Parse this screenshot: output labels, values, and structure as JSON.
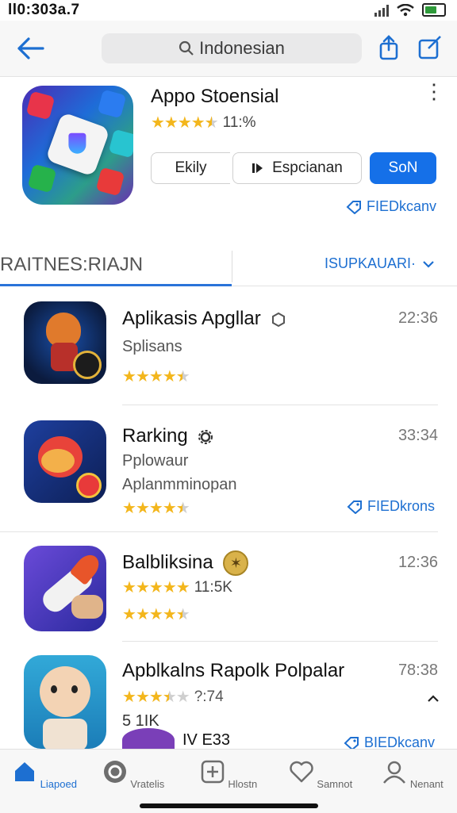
{
  "status": {
    "time": "ll0:303a.7"
  },
  "nav": {
    "search_text": "Indonesian"
  },
  "hero": {
    "title": "Appo Stoensial",
    "rating_text": "11:%",
    "btn_left": "Ekily",
    "btn_mid": "Espcianan",
    "btn_primary": "SoN",
    "link": "FIEDkcanv"
  },
  "tabs": {
    "left": "RAITNES:RIAJN",
    "right": "ISUPKAUARI·"
  },
  "list": [
    {
      "title": "Aplikasis Apgllar",
      "sub": "Splisans",
      "time": "22:36",
      "stars": 4.5
    },
    {
      "title": "Rarking",
      "sub": "Pplowaur",
      "sub2": "Aplanmminopan",
      "time": "33:34",
      "stars": 4.5,
      "link": "FIEDkrons"
    },
    {
      "title": "Balbliksina",
      "rating_text": "11:5K",
      "time": "12:36",
      "stars": 5,
      "stars2": 4.5
    },
    {
      "title": "Apblkalns Rapolk Polpalar",
      "rating_text": "?:74",
      "sub": "5 1IK",
      "time": "78:38",
      "stars": 3.5,
      "link": "BIEDkcanv",
      "foot": "IV E33"
    }
  ],
  "bottom": [
    {
      "label": "Liapoed",
      "icon": "home-icon",
      "active": true
    },
    {
      "label": "Vratelis",
      "icon": "record-icon"
    },
    {
      "label": "Hlostn",
      "icon": "add-box-icon"
    },
    {
      "label": "Samnot",
      "icon": "heart-icon"
    },
    {
      "label": "Nenant",
      "icon": "person-icon"
    }
  ],
  "colors": {
    "accent": "#1570e8",
    "star": "#f3b61c"
  }
}
